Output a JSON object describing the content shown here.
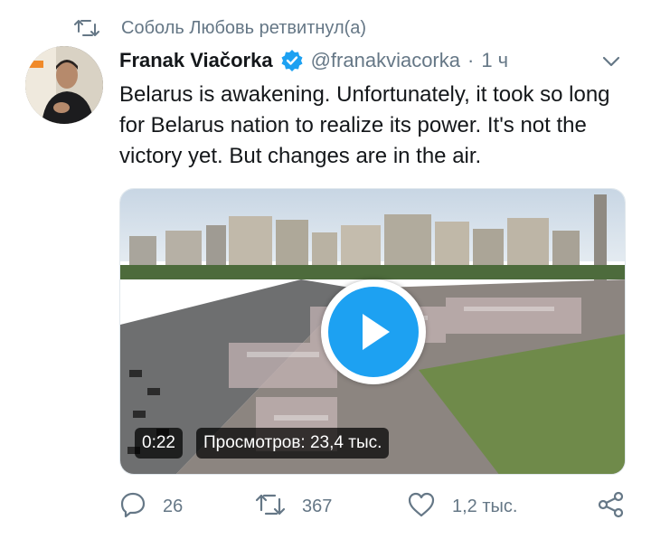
{
  "retweet": {
    "text": "Соболь Любовь ретвитнул(а)",
    "icon": "retweet-icon"
  },
  "author": {
    "name": "Franak Viačorka",
    "handle": "@franakviacorka",
    "separator": "·",
    "time": "1 ч",
    "verified": true
  },
  "tweet": {
    "text": "Belarus is awakening. Unfortunately, it took so long for Belarus nation to realize its power. It's not the victory yet. But changes are in the air."
  },
  "media": {
    "duration": "0:22",
    "views": "Просмотров: 23,4 тыс.",
    "play_icon": "play-icon"
  },
  "actions": {
    "replies": "26",
    "retweets": "367",
    "likes": "1,2 тыс."
  },
  "colors": {
    "accent": "#1da1f2",
    "muted": "#657786",
    "text": "#14171a"
  }
}
